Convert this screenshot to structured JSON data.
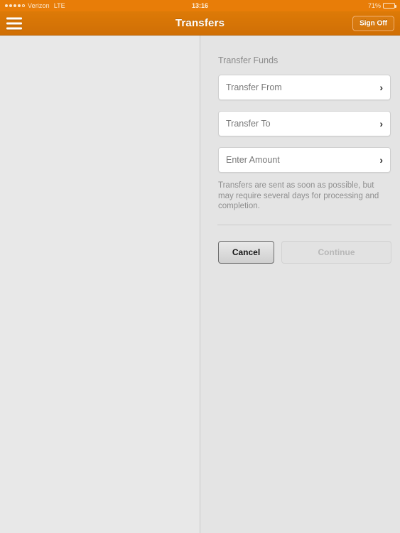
{
  "statusbar": {
    "carrier": "Verizon",
    "network": "LTE",
    "time": "13:16",
    "battery_percent": "71%",
    "signal_dots_filled": 4,
    "signal_dots_total": 5
  },
  "navbar": {
    "menu_icon": "hamburger-menu-icon",
    "title": "Transfers",
    "sign_off_label": "Sign Off"
  },
  "main": {
    "section_title": "Transfer Funds",
    "fields": [
      {
        "label": "Transfer From",
        "chevron": "›"
      },
      {
        "label": "Transfer To",
        "chevron": "›"
      },
      {
        "label": "Enter Amount",
        "chevron": "›"
      }
    ],
    "disclaimer": "Transfers are sent as soon as possible, but may require several days for processing and completion.",
    "buttons": {
      "cancel_label": "Cancel",
      "continue_label": "Continue"
    }
  },
  "colors": {
    "status_orange": "#e87d08",
    "nav_orange": "#d87508",
    "background_gray": "#e4e4e4",
    "left_pane_gray": "#e8e8e8",
    "field_white": "#ffffff",
    "muted_text": "#8f8f8f"
  }
}
